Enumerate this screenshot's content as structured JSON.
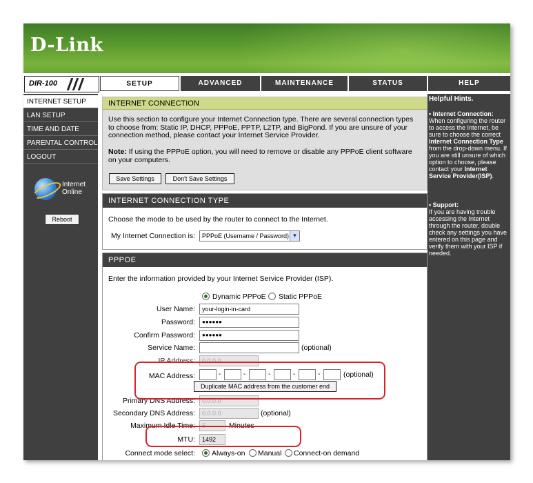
{
  "brand": {
    "logo_text": "D-Link"
  },
  "model": {
    "name": "DIR-100"
  },
  "tabs": [
    {
      "label": "SETUP",
      "active": true
    },
    {
      "label": "ADVANCED",
      "active": false
    },
    {
      "label": "MAINTENANCE",
      "active": false
    },
    {
      "label": "STATUS",
      "active": false
    },
    {
      "label": "HELP",
      "active": false
    }
  ],
  "sidebar": {
    "items": [
      {
        "label": "INTERNET SETUP",
        "active": true
      },
      {
        "label": "LAN SETUP",
        "active": false
      },
      {
        "label": "TIME AND DATE",
        "active": false
      },
      {
        "label": "PARENTAL CONTROL",
        "active": false
      },
      {
        "label": "LOGOUT",
        "active": false
      }
    ],
    "status_line1": "Internet",
    "status_line2": "Online",
    "reboot_label": "Reboot"
  },
  "internet_connection": {
    "title": "INTERNET CONNECTION",
    "description": "Use this section to configure your Internet Connection type. There are several connection types to choose from: Static IP, DHCP, PPPoE, PPTP, L2TP, and BigPond. If you are unsure of your connection method, please contact your Internet Service Provider.",
    "note_label": "Note:",
    "note_text": " If using the PPPoE option, you will need to remove or disable any PPPoE client software on your computers.",
    "save_label": "Save Settings",
    "dont_save_label": "Don't Save Settings"
  },
  "connection_type": {
    "title": "INTERNET CONNECTION TYPE",
    "description": "Choose the mode to be used by the router to connect to the Internet.",
    "select_label": "My Internet Connection is:",
    "select_value": "PPPoE (Username / Password)"
  },
  "pppoe": {
    "title": "PPPOE",
    "description": "Enter the information provided by your Internet Service Provider (ISP).",
    "radio_dynamic": "Dynamic PPPoE",
    "radio_static": "Static PPPoE",
    "username_label": "User Name:",
    "username_value": "your-login-in-card",
    "password_label": "Password:",
    "password_value": "●●●●●●",
    "confirm_label": "Confirm Password:",
    "confirm_value": "●●●●●●",
    "service_label": "Service Name:",
    "service_value": "",
    "optional": "(optional)",
    "ip_label": "IP Address:",
    "ip_value": "0.0.0.0",
    "mac_label": "MAC Address:",
    "mac_optional": "(optional)",
    "dup_mac_label": "Duplicate MAC address from the customer end",
    "primary_dns_label": "Primary DNS Address:",
    "primary_dns_value": "0.0.0.0",
    "secondary_dns_label": "Secondary DNS Address:",
    "secondary_dns_value": "0.0.0.0",
    "secondary_optional": "(optional)",
    "idle_label": "Maximum Idle Time:",
    "idle_value": "5",
    "idle_unit": "Minutes",
    "mtu_label": "MTU:",
    "mtu_value": "1492",
    "connect_label": "Connect mode select:",
    "mode_always": "Always-on",
    "mode_manual": "Manual",
    "mode_demand": "Connect-on demand"
  },
  "help": {
    "title": "Helpful Hints.",
    "h1_title": "• Internet Connection:",
    "h1_text_a": "When configuring the router to access the Internet, be sure to choose the correct ",
    "h1_bold_a": "Internet Connection Type",
    "h1_text_b": " from the drop-down menu. If you are still unsure of which option to choose, please contact your ",
    "h1_bold_b": "Internet Service Provider(ISP)",
    "h1_text_c": ".",
    "h2_title": "• Support:",
    "h2_text": "If you are having trouble accessing the Internet through the router, double check any settings you have entered on this page and verify them with your ISP if needed."
  },
  "colors": {
    "header_green": "#5b9a2e",
    "nav_dark": "#404040",
    "section_title_green": "#cfd989",
    "highlight_red": "#d6232b"
  }
}
